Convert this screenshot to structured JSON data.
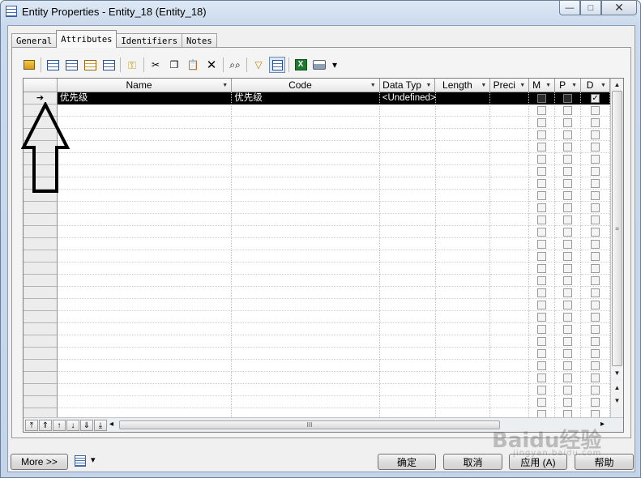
{
  "window": {
    "title": "Entity Properties - Entity_18 (Entity_18)",
    "min": "—",
    "max": "□",
    "close": "✕"
  },
  "tabs": [
    "General",
    "Attributes",
    "Identifiers",
    "Notes"
  ],
  "active_tab": "Attributes",
  "toolbar": {
    "icons": [
      "properties-icon",
      "insert-row-icon",
      "add-row-icon",
      "add-attributes-icon",
      "reuse-attributes-icon",
      "create-identifier-icon",
      "cut-icon",
      "copy-icon",
      "paste-icon",
      "delete-icon",
      "find-icon",
      "filter-icon",
      "customize-columns-icon",
      "excel-export-icon",
      "print-icon",
      "dropdown-arrow-icon"
    ],
    "glyphs": {
      "cut": "✂",
      "copy": "❐",
      "paste": "📋",
      "delete": "✕",
      "find": "🔍",
      "filter": "▽",
      "dropdown": "▾",
      "excel": "X"
    }
  },
  "grid": {
    "columns": [
      {
        "key": "name",
        "label": "Name"
      },
      {
        "key": "code",
        "label": "Code"
      },
      {
        "key": "dtype",
        "label": "Data Typ"
      },
      {
        "key": "length",
        "label": "Length"
      },
      {
        "key": "prec",
        "label": "Preci"
      },
      {
        "key": "m",
        "label": "M"
      },
      {
        "key": "p",
        "label": "P"
      },
      {
        "key": "d",
        "label": "D"
      }
    ],
    "rows": [
      {
        "marker": "➔",
        "name": "优先级",
        "code": "优先级",
        "dtype": "<Undefined>",
        "length": "",
        "prec": "",
        "m": false,
        "p": false,
        "d": true
      }
    ],
    "empty_rows": 26,
    "check_mark": "✓"
  },
  "scroll": {
    "up": "▲",
    "down": "▼",
    "thumb_grip": "≡",
    "left": "◂",
    "right": "▸",
    "h_grip": "III",
    "nav": [
      "⤒",
      "⇑",
      "↑",
      "↓",
      "⇓",
      "⤓"
    ]
  },
  "buttons": {
    "more": "More >>",
    "ok": "确定",
    "cancel": "取消",
    "apply": "应用 (A)",
    "help": "帮助"
  },
  "watermark": {
    "main": "Baidu经验",
    "sub": "jingyan.baidu.com"
  }
}
